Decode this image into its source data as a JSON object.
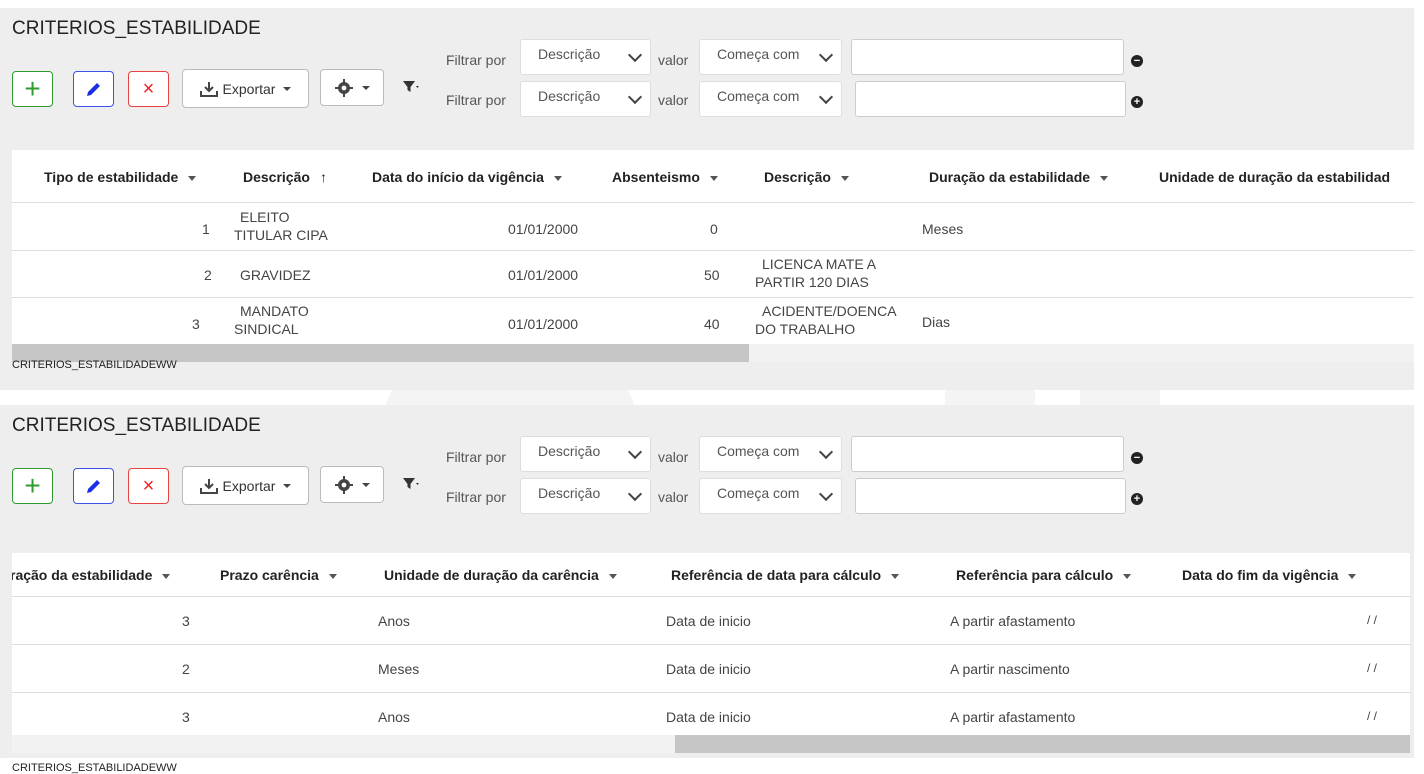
{
  "panels": [
    {
      "title": "CRITERIOS_ESTABILIDADE",
      "toolbar": {
        "add_label": "+",
        "delete_label": "×",
        "export_label": "Exportar"
      },
      "filters": [
        {
          "label": "Filtrar por",
          "field": "Descrição",
          "op_label": "valor",
          "op": "Começa com",
          "value": "",
          "action": "−"
        },
        {
          "label": "Filtrar por",
          "field": "Descrição",
          "op_label": "valor",
          "op": "Começa com",
          "value": "",
          "action": "+"
        }
      ],
      "columns": [
        "Tipo de estabilidade",
        "Descrição",
        "Data do início da vigência",
        "Absenteismo",
        "Descrição",
        "Duração da estabilidade",
        "Unidade de duração da estabilidad"
      ],
      "rows": [
        {
          "tipo": "1",
          "desc_a": "ELEITO",
          "desc_b": "TITULAR CIPA",
          "data": "01/01/2000",
          "abs": "0",
          "desc2_a": "",
          "desc2_b": "",
          "dur": "Meses"
        },
        {
          "tipo": "2",
          "desc_a": "GRAVIDEZ",
          "desc_b": "",
          "data": "01/01/2000",
          "abs": "50",
          "desc2_a": "LICENCA MATE A",
          "desc2_b": "PARTIR 120 DIAS",
          "dur": ""
        },
        {
          "tipo": "3",
          "desc_a": "MANDATO",
          "desc_b": "SINDICAL",
          "data": "01/01/2000",
          "abs": "40",
          "desc2_a": "ACIDENTE/DOENCA",
          "desc2_b": "DO TRABALHO",
          "dur": "Dias"
        }
      ],
      "footer": "CRITERIOS_ESTABILIDADEWW",
      "scroll_position": 0
    },
    {
      "title": "CRITERIOS_ESTABILIDADE",
      "toolbar": {
        "add_label": "+",
        "delete_label": "×",
        "export_label": "Exportar"
      },
      "filters": [
        {
          "label": "Filtrar por",
          "field": "Descrição",
          "op_label": "valor",
          "op": "Começa com",
          "value": "",
          "action": "−"
        },
        {
          "label": "Filtrar por",
          "field": "Descrição",
          "op_label": "valor",
          "op": "Começa com",
          "value": "",
          "action": "+"
        }
      ],
      "columns": [
        "ração da estabilidade",
        "Prazo carência",
        "Unidade de duração da carência",
        "Referência de data para cálculo",
        "Referência para cálculo",
        "Data do fim da vigência"
      ],
      "rows": [
        {
          "dur": "3",
          "prazo": "",
          "unid": "Anos",
          "refdata": "Data de inicio",
          "ref": "A partir afastamento",
          "fim": "/ /"
        },
        {
          "dur": "2",
          "prazo": "",
          "unid": "Meses",
          "refdata": "Data de inicio",
          "ref": "A partir nascimento",
          "fim": "/ /"
        },
        {
          "dur": "3",
          "prazo": "",
          "unid": "Anos",
          "refdata": "Data de inicio",
          "ref": "A partir afastamento",
          "fim": "/ /"
        }
      ],
      "footer": "CRITERIOS_ESTABILIDADEWW",
      "scroll_position": 1
    }
  ],
  "colors": {
    "add": "#2e9b2e",
    "edit": "#1c2ee6",
    "delete": "#e22222",
    "panel_bg": "#eeeeee"
  },
  "icons": [
    "plus-icon",
    "pencil-icon",
    "close-icon",
    "download-icon",
    "gear-icon",
    "filter-icon",
    "minus-circle-icon",
    "plus-circle-icon",
    "sort-caret-icon",
    "sort-up-arrow-icon",
    "chevron-down-icon"
  ]
}
